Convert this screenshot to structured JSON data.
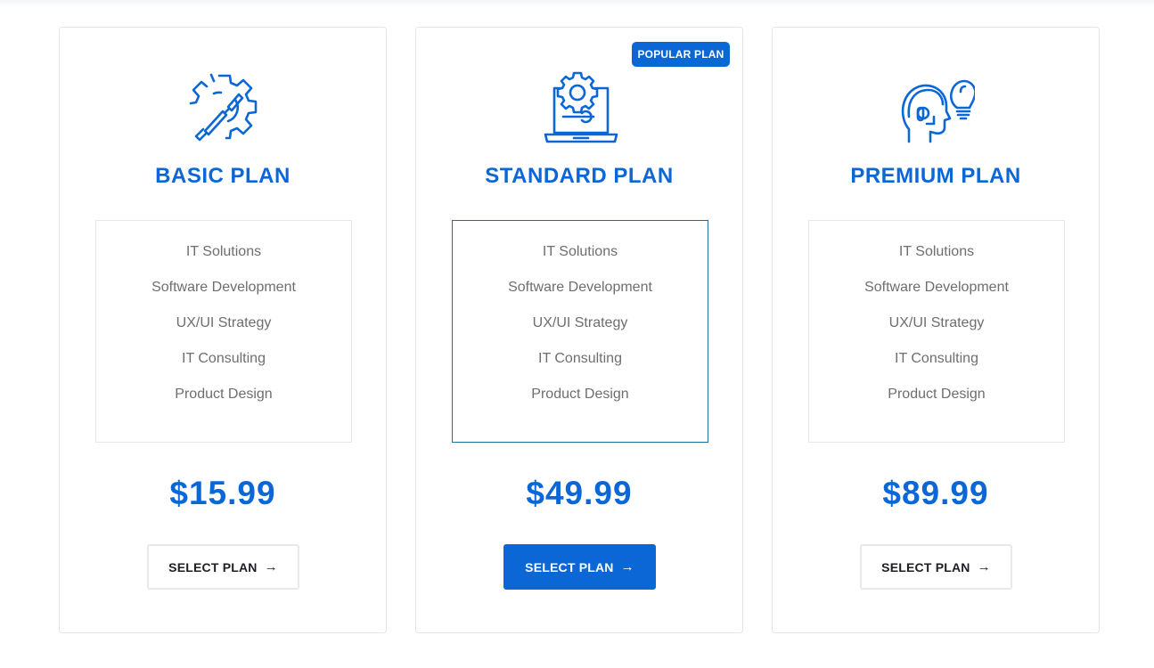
{
  "colors": {
    "accent": "#0b67d6",
    "feature_text": "#6e6e6e",
    "border": "#e4e6ea"
  },
  "plans": [
    {
      "icon": "gear-wrench-icon",
      "title": "BASIC PLAN",
      "features": [
        "IT Solutions",
        "Software Development",
        "UX/UI Strategy",
        "IT Consulting",
        "Product Design"
      ],
      "price": "$15.99",
      "button_label": "SELECT PLAN",
      "button_arrow": "→"
    },
    {
      "badge": "POPULAR PLAN",
      "icon": "laptop-gear-icon",
      "title": "STANDARD PLAN",
      "features": [
        "IT Solutions",
        "Software Development",
        "UX/UI Strategy",
        "IT Consulting",
        "Product Design"
      ],
      "price": "$49.99",
      "button_label": "SELECT PLAN",
      "button_arrow": "→"
    },
    {
      "icon": "head-headset-bulb-icon",
      "title": "PREMIUM PLAN",
      "features": [
        "IT Solutions",
        "Software Development",
        "UX/UI Strategy",
        "IT Consulting",
        "Product Design"
      ],
      "price": "$89.99",
      "button_label": "SELECT PLAN",
      "button_arrow": "→"
    }
  ]
}
